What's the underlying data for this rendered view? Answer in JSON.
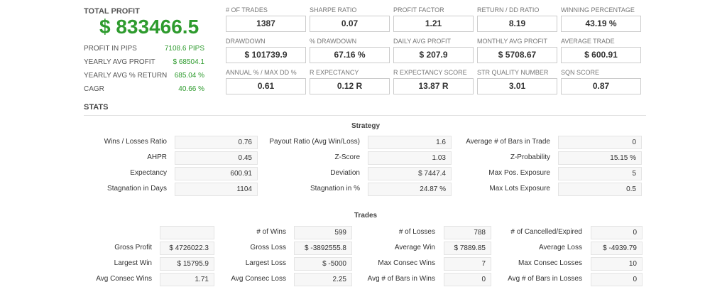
{
  "summary": {
    "title": "TOTAL PROFIT",
    "total_profit": "$ 833466.5",
    "rows": [
      {
        "label": "PROFIT IN PIPS",
        "value": "7108.6 PIPS"
      },
      {
        "label": "YEARLY AVG PROFIT",
        "value": "$ 68504.1"
      },
      {
        "label": "YEARLY AVG % RETURN",
        "value": "685.04 %"
      },
      {
        "label": "CAGR",
        "value": "40.66 %"
      }
    ]
  },
  "metrics": [
    {
      "label": "# OF TRADES",
      "value": "1387"
    },
    {
      "label": "SHARPE RATIO",
      "value": "0.07"
    },
    {
      "label": "PROFIT FACTOR",
      "value": "1.21"
    },
    {
      "label": "RETURN / DD RATIO",
      "value": "8.19"
    },
    {
      "label": "WINNING PERCENTAGE",
      "value": "43.19 %"
    },
    {
      "label": "DRAWDOWN",
      "value": "$ 101739.9"
    },
    {
      "label": "% DRAWDOWN",
      "value": "67.16 %"
    },
    {
      "label": "DAILY AVG PROFIT",
      "value": "$ 207.9"
    },
    {
      "label": "MONTHLY AVG PROFIT",
      "value": "$ 5708.67"
    },
    {
      "label": "AVERAGE TRADE",
      "value": "$ 600.91"
    },
    {
      "label": "ANNUAL % / MAX DD %",
      "value": "0.61"
    },
    {
      "label": "R EXPECTANCY",
      "value": "0.12 R"
    },
    {
      "label": "R EXPECTANCY SCORE",
      "value": "13.87 R"
    },
    {
      "label": "STR QUALITY NUMBER",
      "value": "3.01"
    },
    {
      "label": "SQN SCORE",
      "value": "0.87"
    }
  ],
  "stats": {
    "heading": "STATS",
    "strategy": {
      "title": "Strategy",
      "rows": [
        [
          {
            "label": "Wins / Losses Ratio",
            "value": "0.76"
          },
          {
            "label": "Payout Ratio (Avg Win/Loss)",
            "value": "1.6"
          },
          {
            "label": "Average # of Bars in Trade",
            "value": "0"
          }
        ],
        [
          {
            "label": "AHPR",
            "value": "0.45"
          },
          {
            "label": "Z-Score",
            "value": "1.03"
          },
          {
            "label": "Z-Probability",
            "value": "15.15 %"
          }
        ],
        [
          {
            "label": "Expectancy",
            "value": "600.91"
          },
          {
            "label": "Deviation",
            "value": "$ 7447.4"
          },
          {
            "label": "Max Pos. Exposure",
            "value": "5"
          }
        ],
        [
          {
            "label": "Stagnation in Days",
            "value": "1104"
          },
          {
            "label": "Stagnation in %",
            "value": "24.87 %"
          },
          {
            "label": "Max Lots Exposure",
            "value": "0.5"
          }
        ]
      ]
    },
    "trades": {
      "title": "Trades",
      "rows": [
        [
          {
            "label": "",
            "value": ""
          },
          {
            "label": "# of Wins",
            "value": "599"
          },
          {
            "label": "# of Losses",
            "value": "788"
          },
          {
            "label": "# of Cancelled/Expired",
            "value": "0"
          }
        ],
        [
          {
            "label": "Gross Profit",
            "value": "$ 4726022.3"
          },
          {
            "label": "Gross Loss",
            "value": "$ -3892555.8"
          },
          {
            "label": "Average Win",
            "value": "$ 7889.85"
          },
          {
            "label": "Average Loss",
            "value": "$ -4939.79"
          }
        ],
        [
          {
            "label": "Largest Win",
            "value": "$ 15795.9"
          },
          {
            "label": "Largest Loss",
            "value": "$ -5000"
          },
          {
            "label": "Max Consec Wins",
            "value": "7"
          },
          {
            "label": "Max Consec Losses",
            "value": "10"
          }
        ],
        [
          {
            "label": "Avg Consec Wins",
            "value": "1.71"
          },
          {
            "label": "Avg Consec Loss",
            "value": "2.25"
          },
          {
            "label": "Avg # of Bars in Wins",
            "value": "0"
          },
          {
            "label": "Avg # of Bars in Losses",
            "value": "0"
          }
        ]
      ]
    }
  }
}
